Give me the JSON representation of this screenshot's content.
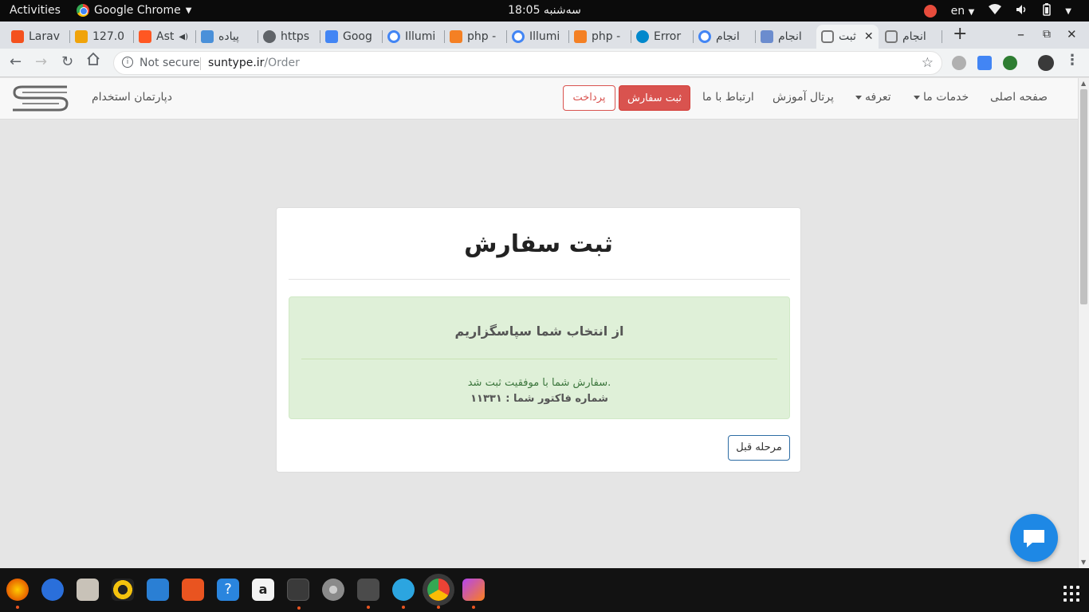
{
  "topbar": {
    "activities": "Activities",
    "app_name": "Google Chrome",
    "clock": "سه‌شنبه 18:05",
    "language": "en"
  },
  "tabs": [
    {
      "label": "Larav",
      "favicon_color": "#f4511e"
    },
    {
      "label": "127.0",
      "favicon_color": "#f0a30a"
    },
    {
      "label": "Ast",
      "favicon_color": "#ff5722"
    },
    {
      "label": "پیاده",
      "favicon_color": "#4a90d9"
    },
    {
      "label": "https",
      "favicon_color": "#5f6368"
    },
    {
      "label": "Goog",
      "favicon_color": "#4285f4"
    },
    {
      "label": "Illumi",
      "favicon_color": "#4285f4"
    },
    {
      "label": "php -",
      "favicon_color": "#f48024"
    },
    {
      "label": "Illumi",
      "favicon_color": "#4285f4"
    },
    {
      "label": "php -",
      "favicon_color": "#f48024"
    },
    {
      "label": "Error",
      "favicon_color": "#0088cc"
    },
    {
      "label": "انجام",
      "favicon_color": "#4285f4"
    },
    {
      "label": "انجام",
      "favicon_color": "#6b8cce"
    },
    {
      "label": "ثبت",
      "favicon_color": "#777777",
      "active": true
    },
    {
      "label": "انجام",
      "favicon_color": "#777777"
    }
  ],
  "toolbar": {
    "not_secure": "Not secure",
    "url_host": "suntype.ir",
    "url_path": "/Order"
  },
  "sitenav": {
    "brand_text": "دپارتمان استخدام",
    "links": {
      "home": "صفحه اصلی",
      "services": "خدمات ما",
      "pricing": "تعرفه",
      "portal": "پرتال آموزش",
      "contact": "ارتباط با ما"
    },
    "order_button": "ثبت سفارش",
    "pay_button": "پرداخت"
  },
  "card": {
    "title": "ثبت سفارش",
    "alert_heading": "از انتخاب شما سپاسگزاریم",
    "alert_message": "سفارش شما با موفقیت ثبت شد.",
    "invoice_line": "شماره فاکتور شما : ۱۱۳۳۱",
    "prev_button": "مرحله قبل"
  },
  "colors": {
    "danger": "#d9534f",
    "success_bg": "#dff0d8",
    "success_text": "#3c763d",
    "chat_bubble": "#1e88e5"
  },
  "dock": [
    {
      "name": "firefox",
      "color": "#e66000"
    },
    {
      "name": "thunderbird",
      "color": "#2a6fdb"
    },
    {
      "name": "files",
      "color": "#c8c2b8"
    },
    {
      "name": "rhythmbox",
      "color": "#f4c20d"
    },
    {
      "name": "libreoffice-writer",
      "color": "#2a7fd4"
    },
    {
      "name": "software-center",
      "color": "#e95420"
    },
    {
      "name": "help",
      "color": "#2a85de"
    },
    {
      "name": "amazon",
      "color": "#f3f3f3"
    },
    {
      "name": "terminal",
      "color": "#3a3a3a"
    },
    {
      "name": "settings",
      "color": "#8a8a8a"
    },
    {
      "name": "sublime-text",
      "color": "#4b4b4b"
    },
    {
      "name": "telegram",
      "color": "#2ca5e0"
    },
    {
      "name": "chrome",
      "color": "#4285f4"
    },
    {
      "name": "phpstorm",
      "color": "#b345f1"
    }
  ]
}
